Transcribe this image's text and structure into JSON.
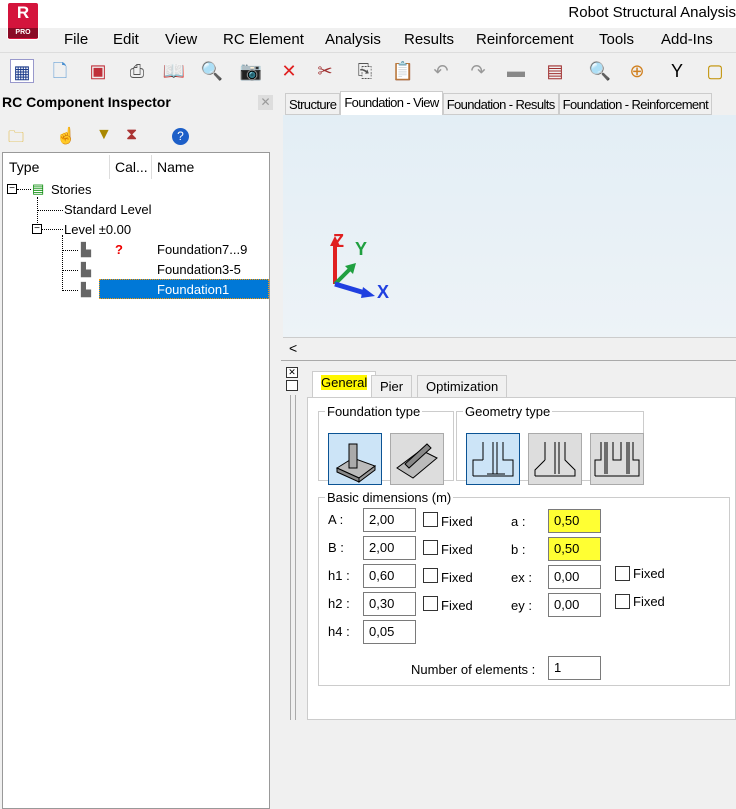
{
  "app": {
    "title": "Robot Structural Analysis",
    "logo_letter": "R",
    "logo_badge": "PRO"
  },
  "menu": [
    "File",
    "Edit",
    "View",
    "RC Element",
    "Analysis",
    "Results",
    "Reinforcement",
    "Tools",
    "Add-Ins"
  ],
  "toolbar": [
    "inspector-icon",
    "new-file-icon",
    "save-icon",
    "print-icon",
    "print-preview-icon",
    "preview-icon",
    "screenshot-icon",
    "delete-icon",
    "cut-icon",
    "copy-icon",
    "paste-icon",
    "undo-icon",
    "redo-icon",
    "display-icon",
    "calculator-icon",
    "zoom-icon",
    "zoom-window-icon",
    "update-icon",
    "table-icon"
  ],
  "inspector": {
    "title": "RC Component Inspector",
    "columns": [
      "Type",
      "Cal...",
      "Name"
    ],
    "tree": {
      "root": "Stories",
      "standard": "Standard Level",
      "level": "Level ±0.00",
      "items": [
        {
          "calc": "?",
          "name": "Foundation7...9"
        },
        {
          "calc": "",
          "name": "Foundation3-5"
        },
        {
          "calc": "",
          "name": "Foundation1"
        }
      ]
    }
  },
  "view_tabs": [
    "Structure",
    "Foundation - View",
    "Foundation - Results",
    "Foundation - Reinforcement"
  ],
  "axes": {
    "z": "Z",
    "y": "Y",
    "x": "X"
  },
  "scroll_left": "<",
  "dialog": {
    "tabs": [
      "General",
      "Pier",
      "Optimization"
    ],
    "foundation_type": "Foundation type",
    "geometry_type": "Geometry type",
    "basic_dimensions": "Basic dimensions (m)",
    "fixed": "Fixed",
    "left_fields": [
      {
        "label": "A :",
        "value": "2,00"
      },
      {
        "label": "B :",
        "value": "2,00"
      },
      {
        "label": "h1 :",
        "value": "0,60"
      },
      {
        "label": "h2 :",
        "value": "0,30"
      },
      {
        "label": "h4 :",
        "value": "0,05"
      }
    ],
    "right_fields": [
      {
        "label": "a :",
        "value": "0,50"
      },
      {
        "label": "b :",
        "value": "0,50"
      },
      {
        "label": "ex :",
        "value": "0,00"
      },
      {
        "label": "ey :",
        "value": "0,00"
      }
    ],
    "num_elements_label": "Number of elements :",
    "num_elements": "1"
  }
}
